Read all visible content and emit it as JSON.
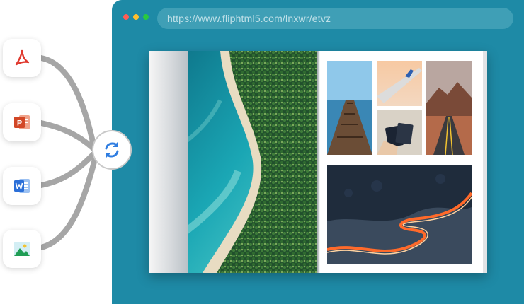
{
  "browser": {
    "url": "https://www.fliphtml5.com/lnxwr/etvz"
  },
  "sources": [
    {
      "name": "pdf-icon",
      "type": "PDF"
    },
    {
      "name": "powerpoint-icon",
      "type": "PowerPoint",
      "glyph": "P"
    },
    {
      "name": "word-icon",
      "type": "Word"
    },
    {
      "name": "image-icon",
      "type": "Image"
    }
  ],
  "hub": {
    "icon": "sync-arrows-icon"
  },
  "colors": {
    "browser_frame": "#1e8aa6",
    "address_bar": "#3f9fb6",
    "pdf": "#e03a2f",
    "powerpoint": "#d24726",
    "word": "#2b6fd8",
    "hub_arrows": "#2f7de1",
    "connector": "#a6a6a6"
  }
}
